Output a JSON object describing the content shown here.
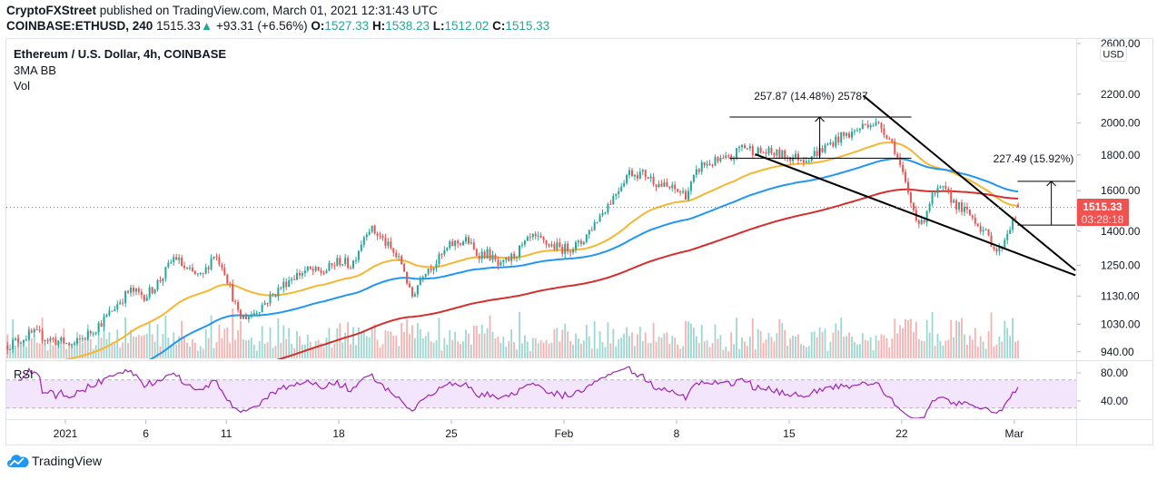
{
  "header": {
    "publisher": "CryptoFXStreet",
    "published_text": "published on TradingView.com, March 01, 2021 12:31:43 UTC",
    "symbol": "COINBASE:ETHUSD, 240",
    "last": "1515.33",
    "change": "+93.31 (+6.56%)",
    "o_label": "O:",
    "o": "1527.33",
    "h_label": "H:",
    "h": "1538.23",
    "l_label": "L:",
    "l": "1512.02",
    "c_label": "C:",
    "c": "1515.33"
  },
  "legend": {
    "title": "Ethereum / U.S. Dollar, 4h, COINBASE",
    "indicator1": "3MA BB",
    "indicator2": "Vol",
    "rsi": "RSI"
  },
  "currency_button": "USD",
  "price_tag": {
    "price": "1515.33",
    "countdown": "03:28:18",
    "color": "#ef5350"
  },
  "footer": {
    "brand": "TradingView"
  },
  "colors": {
    "up": "#26a69a",
    "down": "#ef5350",
    "rsi": "#9c27b0",
    "rsi_band": "#f3e5fc"
  },
  "chart_data": {
    "type": "candlestick",
    "title": "Ethereum / U.S. Dollar, 4h, COINBASE",
    "x_unit": "days since 2021-01-01",
    "y_scale": "log",
    "ylim": [
      940,
      2600
    ],
    "y_ticks": [
      "2600.00",
      "2200.00",
      "2000.00",
      "1800.00",
      "1600.00",
      "1400.00",
      "1250.00",
      "1130.00",
      "1030.00",
      "940.00"
    ],
    "y_tick_values": [
      2600,
      2200,
      2000,
      1800,
      1600,
      1400,
      1250,
      1130,
      1030,
      940
    ],
    "x_ticks": [
      {
        "t": 0,
        "label": "2021"
      },
      {
        "t": 5,
        "label": "6"
      },
      {
        "t": 10,
        "label": "11"
      },
      {
        "t": 17,
        "label": "18"
      },
      {
        "t": 24,
        "label": "25"
      },
      {
        "t": 31,
        "label": "Feb"
      },
      {
        "t": 38,
        "label": "8"
      },
      {
        "t": 45,
        "label": "15"
      },
      {
        "t": 52,
        "label": "22"
      },
      {
        "t": 59,
        "label": "Mar"
      }
    ],
    "bar_hours": 4,
    "close_keypoints": [
      [
        -3.6,
        960
      ],
      [
        -2,
        1000
      ],
      [
        -1,
        980
      ],
      [
        0.5,
        960
      ],
      [
        1.5,
        1000
      ],
      [
        2.5,
        1050
      ],
      [
        3.2,
        1100
      ],
      [
        4,
        1150
      ],
      [
        5,
        1130
      ],
      [
        6,
        1200
      ],
      [
        6.8,
        1290
      ],
      [
        7.5,
        1230
      ],
      [
        8.5,
        1200
      ],
      [
        9.2,
        1300
      ],
      [
        9.8,
        1250
      ],
      [
        10.3,
        1150
      ],
      [
        10.8,
        1050
      ],
      [
        11.5,
        1060
      ],
      [
        12.3,
        1100
      ],
      [
        13,
        1140
      ],
      [
        14,
        1200
      ],
      [
        15,
        1230
      ],
      [
        16,
        1220
      ],
      [
        17,
        1270
      ],
      [
        17.8,
        1250
      ],
      [
        18.8,
        1420
      ],
      [
        19.5,
        1380
      ],
      [
        20.2,
        1320
      ],
      [
        21,
        1250
      ],
      [
        21.5,
        1120
      ],
      [
        22.3,
        1230
      ],
      [
        23,
        1260
      ],
      [
        24,
        1340
      ],
      [
        25,
        1360
      ],
      [
        25.5,
        1300
      ],
      [
        26.3,
        1300
      ],
      [
        27,
        1240
      ],
      [
        28,
        1300
      ],
      [
        29,
        1370
      ],
      [
        30,
        1340
      ],
      [
        31,
        1320
      ],
      [
        32,
        1340
      ],
      [
        33,
        1450
      ],
      [
        34,
        1560
      ],
      [
        35,
        1700
      ],
      [
        36,
        1690
      ],
      [
        37,
        1630
      ],
      [
        38,
        1600
      ],
      [
        38.6,
        1580
      ],
      [
        39.5,
        1740
      ],
      [
        40.5,
        1760
      ],
      [
        41.5,
        1780
      ],
      [
        42,
        1860
      ],
      [
        43,
        1820
      ],
      [
        44,
        1810
      ],
      [
        45,
        1790
      ],
      [
        46,
        1780
      ],
      [
        47,
        1830
      ],
      [
        48,
        1900
      ],
      [
        49,
        1940
      ],
      [
        50,
        2010
      ],
      [
        50.8,
        1970
      ],
      [
        51.5,
        1860
      ],
      [
        52,
        1700
      ],
      [
        52.5,
        1550
      ],
      [
        53.2,
        1420
      ],
      [
        53.8,
        1560
      ],
      [
        54.5,
        1610
      ],
      [
        55.5,
        1520
      ],
      [
        56.5,
        1460
      ],
      [
        57.5,
        1360
      ],
      [
        58,
        1300
      ],
      [
        58.7,
        1420
      ],
      [
        59.1,
        1470
      ],
      [
        59.3,
        1515.33
      ]
    ],
    "last_bar": {
      "open": 1527.33,
      "high": 1538.23,
      "low": 1512.02,
      "close": 1515.33
    },
    "moving_averages": [
      {
        "name": "MA fast",
        "length": 50,
        "color": "#f5b731"
      },
      {
        "name": "MA mid",
        "length": 100,
        "color": "#2196f3"
      },
      {
        "name": "MA slow",
        "length": 200,
        "color": "#d32f2f"
      }
    ],
    "rsi": {
      "length": 14,
      "ylim": [
        10,
        95
      ],
      "ticks": [
        "80.00",
        "40.00"
      ],
      "tick_values": [
        80,
        40
      ],
      "band": [
        30,
        70
      ]
    },
    "drawings": {
      "trendlines": [
        {
          "name": "upper-trendline",
          "from": [
            49.6,
            2190
          ],
          "to": [
            62.8,
            1230
          ]
        },
        {
          "name": "lower-trendline",
          "from": [
            42.9,
            1804
          ],
          "to": [
            62.8,
            1210
          ]
        }
      ],
      "measures": [
        {
          "name": "measure-1",
          "label": "257.87 (14.48%) 25787",
          "t_from": 41.3,
          "t_to": 52.6,
          "low": 1781,
          "high": 2040,
          "arrow_t": 46.9
        },
        {
          "name": "measure-2",
          "label": "227.49 (15.92%)",
          "t_from": 59.2,
          "t_to": 62.8,
          "low": 1428,
          "high": 1650,
          "arrow_t": 61.3
        }
      ]
    }
  }
}
